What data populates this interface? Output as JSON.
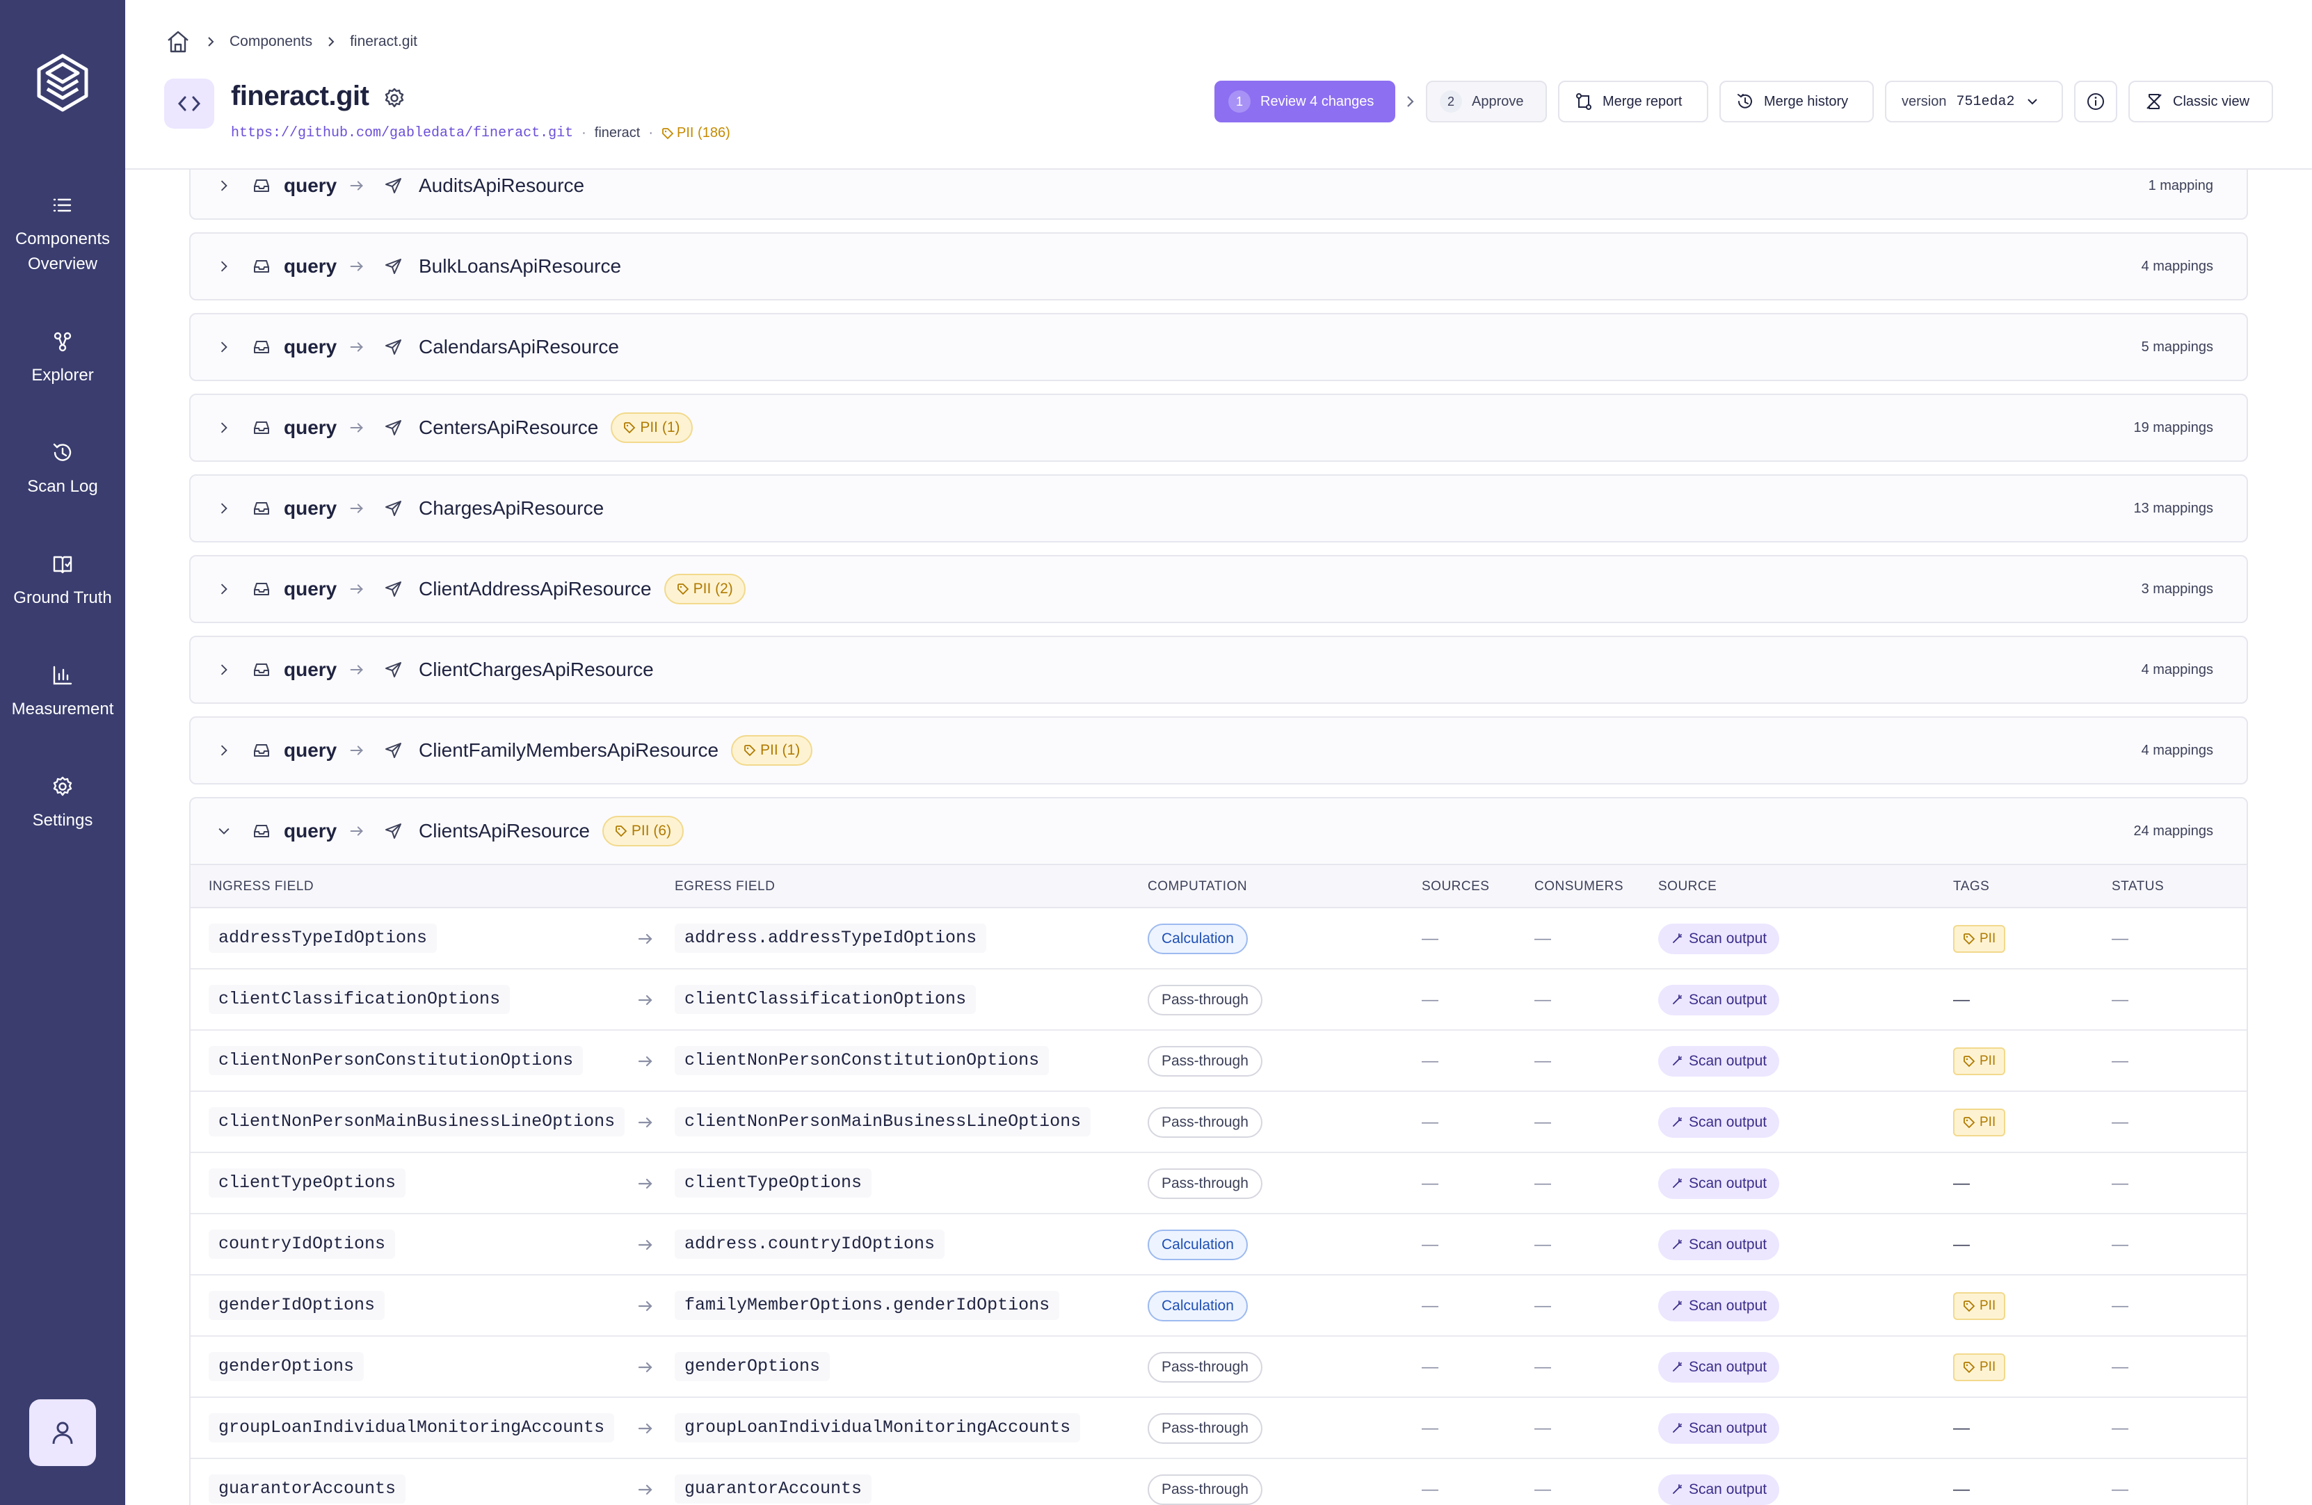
{
  "sidebar": {
    "items": [
      {
        "label": "Components Overview",
        "icon": "list-icon"
      },
      {
        "label": "Explorer",
        "icon": "graph-icon"
      },
      {
        "label": "Scan Log",
        "icon": "history-icon"
      },
      {
        "label": "Ground Truth",
        "icon": "book-icon"
      },
      {
        "label": "Measurement",
        "icon": "bar-chart-icon"
      },
      {
        "label": "Settings",
        "icon": "gear-icon"
      }
    ]
  },
  "breadcrumb": {
    "components": "Components",
    "current": "fineract.git"
  },
  "header": {
    "title": "fineract.git",
    "url": "https://github.com/gabledata/fineract.git",
    "project": "fineract",
    "pii_summary": "PII (186)"
  },
  "actions": {
    "review_step": "1",
    "review_label": "Review 4 changes",
    "approve_step": "2",
    "approve_label": "Approve",
    "merge_report": "Merge report",
    "merge_history": "Merge history",
    "version_label": "version",
    "version_value": "751eda2",
    "classic_view": "Classic view"
  },
  "groups": [
    {
      "kind": "query",
      "name": "AuditsApiResource",
      "pii": "",
      "count": "1 mapping"
    },
    {
      "kind": "query",
      "name": "BulkLoansApiResource",
      "pii": "",
      "count": "4 mappings"
    },
    {
      "kind": "query",
      "name": "CalendarsApiResource",
      "pii": "",
      "count": "5 mappings"
    },
    {
      "kind": "query",
      "name": "CentersApiResource",
      "pii": "PII (1)",
      "count": "19 mappings"
    },
    {
      "kind": "query",
      "name": "ChargesApiResource",
      "pii": "",
      "count": "13 mappings"
    },
    {
      "kind": "query",
      "name": "ClientAddressApiResource",
      "pii": "PII (2)",
      "count": "3 mappings"
    },
    {
      "kind": "query",
      "name": "ClientChargesApiResource",
      "pii": "",
      "count": "4 mappings"
    },
    {
      "kind": "query",
      "name": "ClientFamilyMembersApiResource",
      "pii": "PII (1)",
      "count": "4 mappings"
    },
    {
      "kind": "query",
      "name": "ClientsApiResource",
      "pii": "PII (6)",
      "count": "24 mappings"
    }
  ],
  "table": {
    "headers": {
      "ingress": "INGRESS FIELD",
      "egress": "EGRESS FIELD",
      "computation": "COMPUTATION",
      "sources": "SOURCES",
      "consumers": "CONSUMERS",
      "source": "SOURCE",
      "tags": "TAGS",
      "status": "STATUS"
    },
    "rows": [
      {
        "ingress": "addressTypeIdOptions",
        "egress": "address.addressTypeIdOptions",
        "computation": "Calculation",
        "sources": "—",
        "consumers": "—",
        "source": "Scan output",
        "tag": "PII",
        "status": "—"
      },
      {
        "ingress": "clientClassificationOptions",
        "egress": "clientClassificationOptions",
        "computation": "Pass-through",
        "sources": "—",
        "consumers": "—",
        "source": "Scan output",
        "tag": "—",
        "status": "—"
      },
      {
        "ingress": "clientNonPersonConstitutionOptions",
        "egress": "clientNonPersonConstitutionOptions",
        "computation": "Pass-through",
        "sources": "—",
        "consumers": "—",
        "source": "Scan output",
        "tag": "PII",
        "status": "—"
      },
      {
        "ingress": "clientNonPersonMainBusinessLineOptions",
        "egress": "clientNonPersonMainBusinessLineOptions",
        "computation": "Pass-through",
        "sources": "—",
        "consumers": "—",
        "source": "Scan output",
        "tag": "PII",
        "status": "—"
      },
      {
        "ingress": "clientTypeOptions",
        "egress": "clientTypeOptions",
        "computation": "Pass-through",
        "sources": "—",
        "consumers": "—",
        "source": "Scan output",
        "tag": "—",
        "status": "—"
      },
      {
        "ingress": "countryIdOptions",
        "egress": "address.countryIdOptions",
        "computation": "Calculation",
        "sources": "—",
        "consumers": "—",
        "source": "Scan output",
        "tag": "—",
        "status": "—"
      },
      {
        "ingress": "genderIdOptions",
        "egress": "familyMemberOptions.genderIdOptions",
        "computation": "Calculation",
        "sources": "—",
        "consumers": "—",
        "source": "Scan output",
        "tag": "PII",
        "status": "—"
      },
      {
        "ingress": "genderOptions",
        "egress": "genderOptions",
        "computation": "Pass-through",
        "sources": "—",
        "consumers": "—",
        "source": "Scan output",
        "tag": "PII",
        "status": "—"
      },
      {
        "ingress": "groupLoanIndividualMonitoringAccounts",
        "egress": "groupLoanIndividualMonitoringAccounts",
        "computation": "Pass-through",
        "sources": "—",
        "consumers": "—",
        "source": "Scan output",
        "tag": "—",
        "status": "—"
      },
      {
        "ingress": "guarantorAccounts",
        "egress": "guarantorAccounts",
        "computation": "Pass-through",
        "sources": "—",
        "consumers": "—",
        "source": "Scan output",
        "tag": "—",
        "status": "—"
      }
    ]
  }
}
